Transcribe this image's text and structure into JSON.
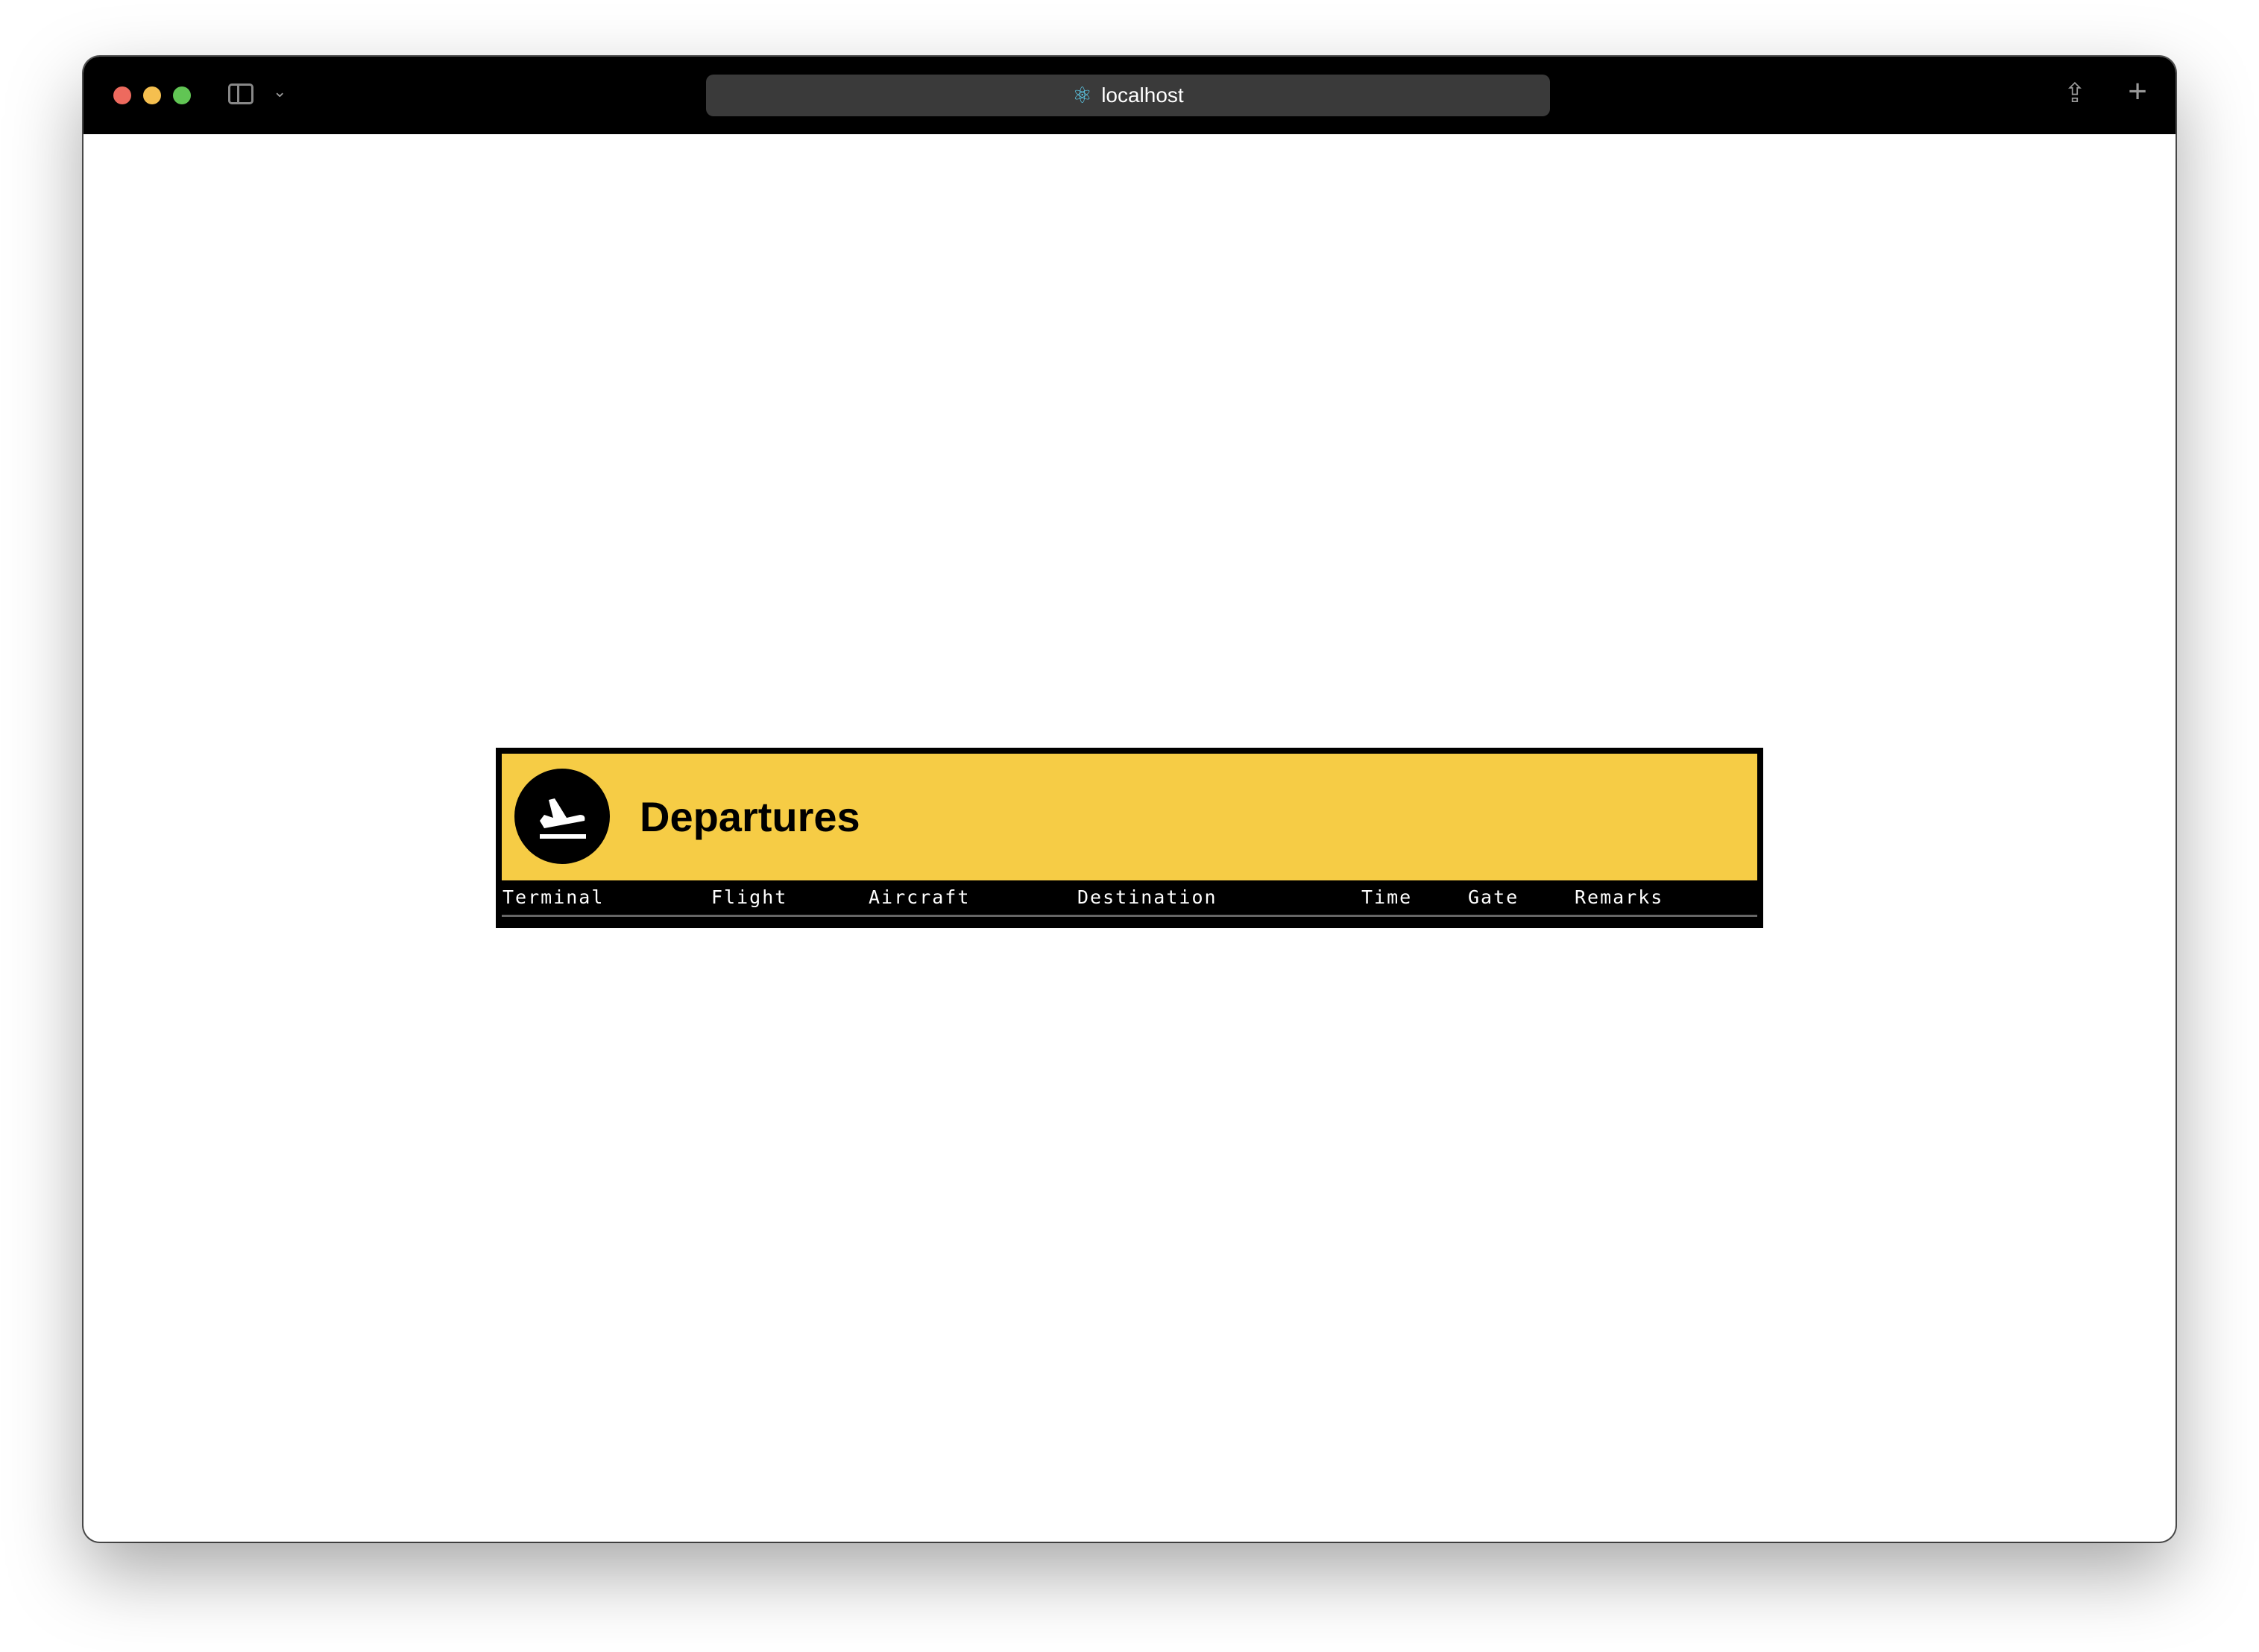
{
  "browser": {
    "url": "localhost",
    "traffic_lights": {
      "close": "#ed6a5e",
      "minimize": "#f5bf4f",
      "maximize": "#61c554"
    },
    "icons": [
      "sidebar-icon",
      "chevron-down-icon",
      "react-icon",
      "share-icon",
      "plus-icon"
    ]
  },
  "board": {
    "title": "Departures",
    "icon": "airplane-departure-icon",
    "accent": "#f6cc45",
    "columns": [
      "Terminal",
      "Flight",
      "Aircraft",
      "Destination",
      "Time",
      "Gate",
      "Remarks"
    ]
  }
}
